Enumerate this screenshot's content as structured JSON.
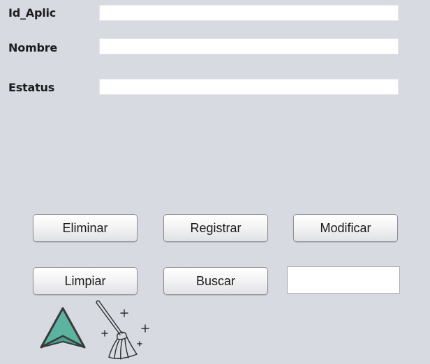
{
  "form": {
    "fields": [
      {
        "label": "Id_Aplic",
        "value": ""
      },
      {
        "label": "Nombre",
        "value": ""
      },
      {
        "label": "Estatus",
        "value": ""
      }
    ]
  },
  "buttons": {
    "eliminar": "Eliminar",
    "registrar": "Registrar",
    "modificar": "Modificar",
    "limpiar": "Limpiar",
    "buscar": "Buscar"
  },
  "search": {
    "value": ""
  },
  "icons": {
    "up_arrow": "arrow-up-icon",
    "broom": "broom-icon"
  },
  "colors": {
    "background": "#d7dae1",
    "arrow_fill": "#5bb3a0",
    "arrow_outline": "#3a3a3a"
  }
}
